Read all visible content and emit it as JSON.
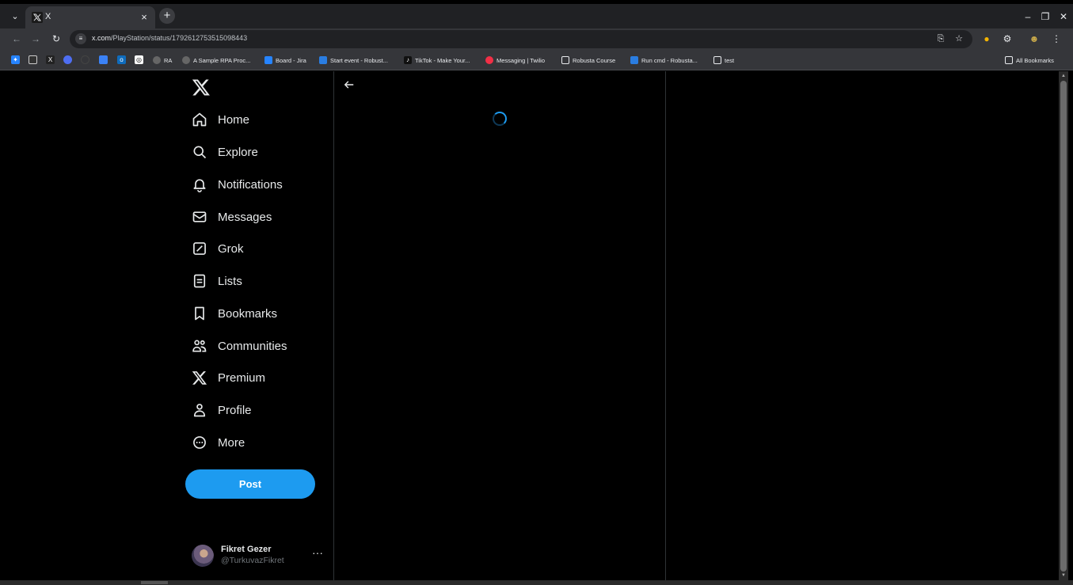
{
  "browser": {
    "tab_title": "X",
    "url_domain": "x.com",
    "url_path": "/PlayStation/status/1792612753515098443"
  },
  "bookmarks": [
    {
      "label": "RA",
      "color": "#555"
    },
    {
      "label": "A Sample RPA Proc...",
      "color": "#555"
    },
    {
      "label": "Board - Jira",
      "color": "#2684ff"
    },
    {
      "label": "Start event - Robust...",
      "color": "#2a7de1"
    },
    {
      "label": "TikTok - Make Your...",
      "color": "#111"
    },
    {
      "label": "Messaging | Twilio",
      "color": "#f22f46"
    },
    {
      "label": "Robusta Course",
      "color": "folder"
    },
    {
      "label": "Run cmd - Robusta...",
      "color": "#2a7de1"
    },
    {
      "label": "test",
      "color": "folder"
    }
  ],
  "all_bookmarks_label": "All Bookmarks",
  "nav": {
    "home": "Home",
    "explore": "Explore",
    "notifications": "Notifications",
    "messages": "Messages",
    "grok": "Grok",
    "lists": "Lists",
    "bookmarks": "Bookmarks",
    "communities": "Communities",
    "premium": "Premium",
    "profile": "Profile",
    "more": "More"
  },
  "post_label": "Post",
  "account": {
    "name": "Fikret Gezer",
    "handle": "@TurkuvazFikret",
    "more": "···"
  },
  "colors": {
    "accent": "#1d9bf0",
    "background": "#000000",
    "border": "#2f3336"
  }
}
